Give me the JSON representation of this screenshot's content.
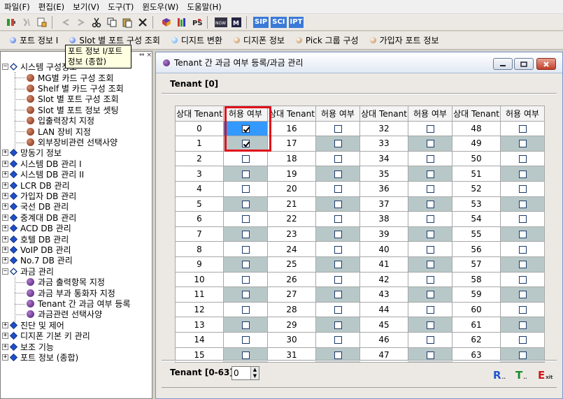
{
  "menubar": [
    "파일(F)",
    "편집(E)",
    "보기(V)",
    "도구(T)",
    "윈도우(W)",
    "도움말(H)"
  ],
  "toolbar": {
    "sip": "SIP",
    "sci": "SCI",
    "ipt": "IPT"
  },
  "navbar": [
    {
      "label": "포트 정보 I",
      "color": "#2255dd"
    },
    {
      "label": "Slot 별 포트 구성 조회",
      "color": "#2255dd"
    },
    {
      "label": "디지트 변환",
      "color": "#4499ee"
    },
    {
      "label": "디지폰 정보",
      "color": "#bb7733"
    },
    {
      "label": "Pick 그룹 구성",
      "color": "#bb7733"
    },
    {
      "label": "가입자 포트 정보",
      "color": "#bb7733"
    }
  ],
  "tooltip": {
    "line1": "포트 정보 I/포트",
    "line2": "정보 (종합)"
  },
  "tree": {
    "root": "시스템 구성정보",
    "root_children": [
      "MG별 카드 구성 조회",
      "Shelf 별 카드 구성 조회",
      "Slot 별 포트 구성 조회",
      "Slot 별 포트 정보 셋팅",
      "입출력장치 지정",
      "LAN 장비 지정",
      "외부장비관련 선택사양"
    ],
    "middle": [
      "망동기 정보",
      "시스템 DB 관리 I",
      "시스템 DB 관리 II",
      "LCR DB 관리",
      "가입자 DB 관리",
      "국선 DB 관리",
      "중계대 DB 관리",
      "ACD DB 관리",
      "호텔 DB 관리",
      "VoIP DB 관리",
      "No.7 DB 관리"
    ],
    "billing": "과금 관리",
    "billing_children": [
      "과금 출력항목 지정",
      "과금 부과 통화자 지정",
      "Tenant 간 과금 여부 등록",
      "과금관련 선택사양"
    ],
    "bottom": [
      "진단 및 제어",
      "디지폰 기본 키 관리",
      "보조 기능",
      "포트 정보 (종합)"
    ]
  },
  "window": {
    "title": "Tenant 간 과금 여부 등록/과금 관리",
    "tenant_header": "Tenant [0]",
    "col_tenant": "상대 Tenant",
    "col_allow": "허용 여부",
    "checked": [
      0,
      1
    ],
    "range_label": "Tenant [0-63]",
    "spin_value": "0",
    "btn_r": "R",
    "btn_t": "T",
    "btn_e": "E",
    "btn_e_sub": "xit"
  }
}
